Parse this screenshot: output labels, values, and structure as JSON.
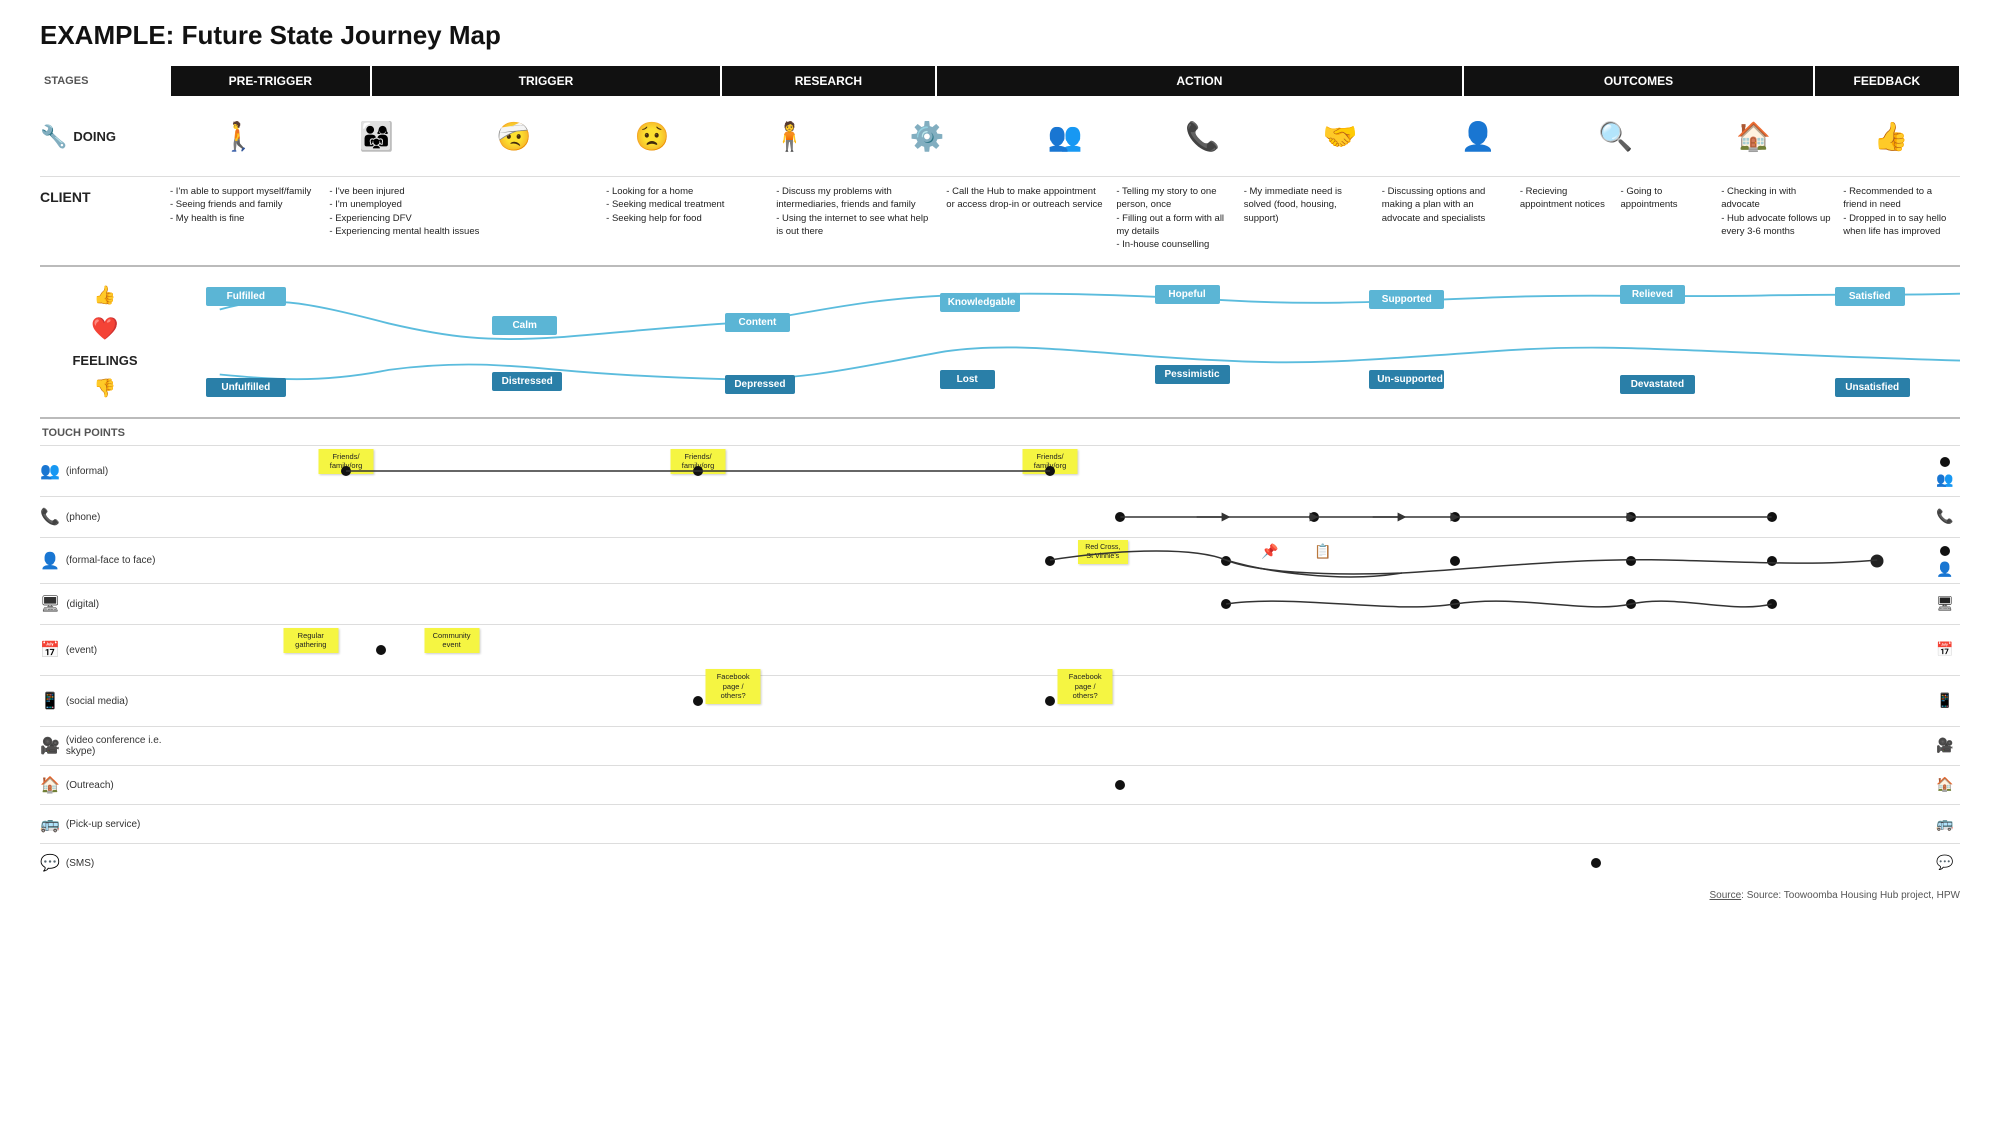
{
  "title": "EXAMPLE: Future State Journey Map",
  "stages_label": "STAGES",
  "stages": [
    {
      "id": "pre-trigger",
      "label": "PRE-TRIGGER",
      "flex": 1.4
    },
    {
      "id": "trigger",
      "label": "TRIGGER",
      "flex": 2.5
    },
    {
      "id": "research",
      "label": "RESEARCH",
      "flex": 1.5
    },
    {
      "id": "action",
      "label": "ACTION",
      "flex": 3.8
    },
    {
      "id": "outcomes",
      "label": "OUTCOMES",
      "flex": 2.5
    },
    {
      "id": "feedback",
      "label": "FEEDBACK",
      "flex": 1.0
    }
  ],
  "doing_label": "DOING",
  "doing_icons": [
    "🚶",
    "👨‍👩‍👧",
    "🤕",
    "🙇",
    "🧍",
    "⚙️",
    "👥",
    "📞",
    "🤝",
    "👤👤",
    "😊🔍",
    "🏠❤️",
    "👍🔍"
  ],
  "client_label": "CLIENT",
  "client_cols": [
    {
      "id": "pre-trigger",
      "text": "- I'm able to support myself/family\n- Seeing friends and family\n- My health is fine"
    },
    {
      "id": "trigger",
      "text": "- I've been injured\n- I'm unemployed\n- Experiencing DFV\n- Experiencing mental health issues"
    },
    {
      "id": "research",
      "text": "- Looking for a home\n- Seeking medical treatment\n- Seeking help for food"
    },
    {
      "id": "research2",
      "text": "- Discuss my problems with intermediaries, friends and family\n- Using the internet to see what help is out there"
    },
    {
      "id": "action1",
      "text": "- Call the Hub to make appointment or access drop-in or outreach service"
    },
    {
      "id": "action2",
      "text": "- Telling my story to one person, once\n- Filling out a form with all my details\n- In-house counselling"
    },
    {
      "id": "action3",
      "text": "- My immediate need is solved (food, housing, support)"
    },
    {
      "id": "action4",
      "text": "- Discussing options and making a plan with an advocate and specialists"
    },
    {
      "id": "outcomes1",
      "text": "- Recieving appointment notices"
    },
    {
      "id": "outcomes2",
      "text": "- Going to appointments"
    },
    {
      "id": "outcomes3",
      "text": "- Checking in with advocate\n- Hub advocate follows up every 3-6 months"
    },
    {
      "id": "feedback",
      "text": "- Recommended to a friend in need\n- Dropped in to say hello when life has improved"
    }
  ],
  "feelings_label": "FEELINGS",
  "feelings": {
    "positive": [
      "Fulfilled",
      "Calm",
      "Content",
      "Knowledgable",
      "Hopeful",
      "Supported",
      "Relieved",
      "Satisfied"
    ],
    "negative": [
      "Unfulfilled",
      "Distressed",
      "Depressed",
      "Lost",
      "Pessimistic",
      "Un-supported",
      "Devastated",
      "Unsatisfied"
    ]
  },
  "touchpoints_label": "TOUCH POINTS",
  "touchpoints": [
    {
      "id": "informal",
      "label": "(informal)",
      "icon": "👥"
    },
    {
      "id": "phone",
      "label": "(phone)",
      "icon": "📞"
    },
    {
      "id": "formal",
      "label": "(formal-face to face)",
      "icon": "👤"
    },
    {
      "id": "digital",
      "label": "(digital)",
      "icon": "🖥"
    },
    {
      "id": "event",
      "label": "(event)",
      "icon": "📅"
    },
    {
      "id": "social",
      "label": "(social media)",
      "icon": "📱"
    },
    {
      "id": "video",
      "label": "(video conference i.e. skype)",
      "icon": "🎥"
    },
    {
      "id": "outreach",
      "label": "(Outreach)",
      "icon": "🏠"
    },
    {
      "id": "pickup",
      "label": "(Pick-up service)",
      "icon": "🚌"
    },
    {
      "id": "sms",
      "label": "(SMS)",
      "icon": "💬"
    }
  ],
  "source": "Source: Toowoomba Housing Hub project, HPW"
}
